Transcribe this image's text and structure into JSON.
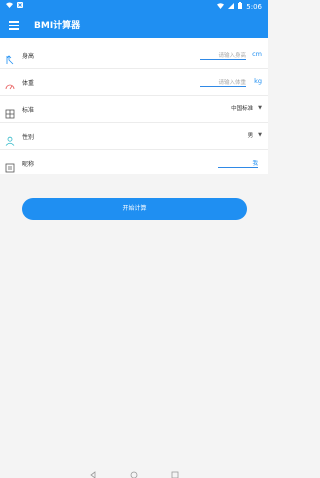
{
  "status_bar": {
    "time": "5:06",
    "icons": [
      "wifi-icon",
      "notification-icon",
      "signal-icon",
      "battery-icon"
    ]
  },
  "app_bar": {
    "title": "BMI计算器",
    "menu_icon": "menu-icon"
  },
  "form": {
    "rows": [
      {
        "label": "身高",
        "icon": "ruler-icon",
        "placeholder": "请输入身高",
        "unit": "cm"
      },
      {
        "label": "体重",
        "icon": "scale-icon",
        "placeholder": "请输入体重",
        "unit": "kg"
      },
      {
        "label": "标准",
        "icon": "grid-icon",
        "selected": "中国标准"
      },
      {
        "label": "性别",
        "icon": "user-icon",
        "selected": "男"
      },
      {
        "label": "昵称",
        "icon": "document-icon",
        "value": "我"
      }
    ]
  },
  "actions": {
    "start_label": "开始计算"
  },
  "colors": {
    "primary": "#1f8ff2",
    "background": "#f4f4f4"
  },
  "nav_bar": {
    "icons": [
      "back-icon",
      "home-icon",
      "recent-apps-icon"
    ]
  }
}
